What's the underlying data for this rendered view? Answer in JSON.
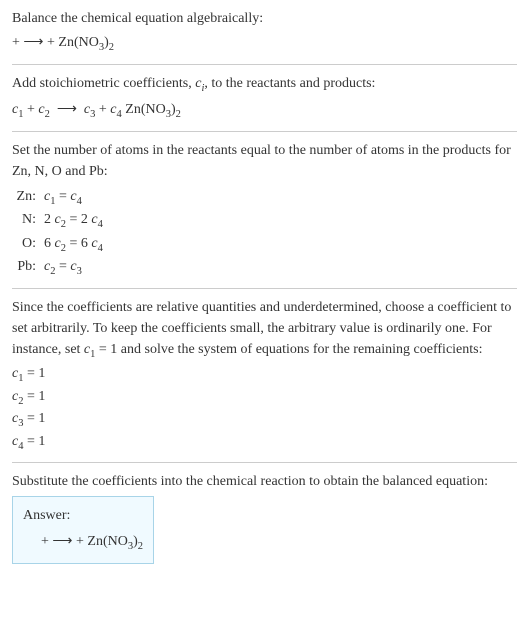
{
  "step1": {
    "heading": "Balance the chemical equation algebraically:",
    "equation_left": " + ",
    "equation_arrow": "⟶",
    "equation_right_prefix": " + ",
    "equation_compound": "Zn(NO",
    "equation_compound_sub1": "3",
    "equation_compound_paren": ")",
    "equation_compound_sub2": "2"
  },
  "step2": {
    "heading_prefix": "Add stoichiometric coefficients, ",
    "heading_var": "c",
    "heading_var_sub": "i",
    "heading_suffix": ", to the reactants and products:",
    "c1": "c",
    "c1_sub": "1",
    "plus1": " + ",
    "c2": "c",
    "c2_sub": "2",
    "arrow": "⟶",
    "c3": "c",
    "c3_sub": "3",
    "plus2": " + ",
    "c4": "c",
    "c4_sub": "4",
    "compound": " Zn(NO",
    "compound_sub1": "3",
    "compound_paren": ")",
    "compound_sub2": "2"
  },
  "step3": {
    "heading": "Set the number of atoms in the reactants equal to the number of atoms in the products for Zn, N, O and Pb:",
    "rows": [
      {
        "label": "Zn:",
        "c_a": "c",
        "sub_a": "1",
        "eq": " = ",
        "c_b": "c",
        "sub_b": "4",
        "prefix_a": "",
        "prefix_b": ""
      },
      {
        "label": "N:",
        "c_a": "c",
        "sub_a": "2",
        "eq": " = 2 ",
        "c_b": "c",
        "sub_b": "4",
        "prefix_a": "2 ",
        "prefix_b": ""
      },
      {
        "label": "O:",
        "c_a": "c",
        "sub_a": "2",
        "eq": " = 6 ",
        "c_b": "c",
        "sub_b": "4",
        "prefix_a": "6 ",
        "prefix_b": ""
      },
      {
        "label": "Pb:",
        "c_a": "c",
        "sub_a": "2",
        "eq": " = ",
        "c_b": "c",
        "sub_b": "3",
        "prefix_a": "",
        "prefix_b": ""
      }
    ]
  },
  "step4": {
    "heading_prefix": "Since the coefficients are relative quantities and underdetermined, choose a coefficient to set arbitrarily. To keep the coefficients small, the arbitrary value is ordinarily one. For instance, set ",
    "heading_var": "c",
    "heading_var_sub": "1",
    "heading_suffix": " = 1 and solve the system of equations for the remaining coefficients:",
    "coeffs": [
      {
        "c": "c",
        "sub": "1",
        "val": " = 1"
      },
      {
        "c": "c",
        "sub": "2",
        "val": " = 1"
      },
      {
        "c": "c",
        "sub": "3",
        "val": " = 1"
      },
      {
        "c": "c",
        "sub": "4",
        "val": " = 1"
      }
    ]
  },
  "step5": {
    "heading": "Substitute the coefficients into the chemical reaction to obtain the balanced equation:"
  },
  "answer": {
    "label": "Answer:",
    "eq_left": " + ",
    "eq_arrow": "⟶",
    "eq_right_prefix": " + ",
    "compound": "Zn(NO",
    "compound_sub1": "3",
    "compound_paren": ")",
    "compound_sub2": "2"
  }
}
